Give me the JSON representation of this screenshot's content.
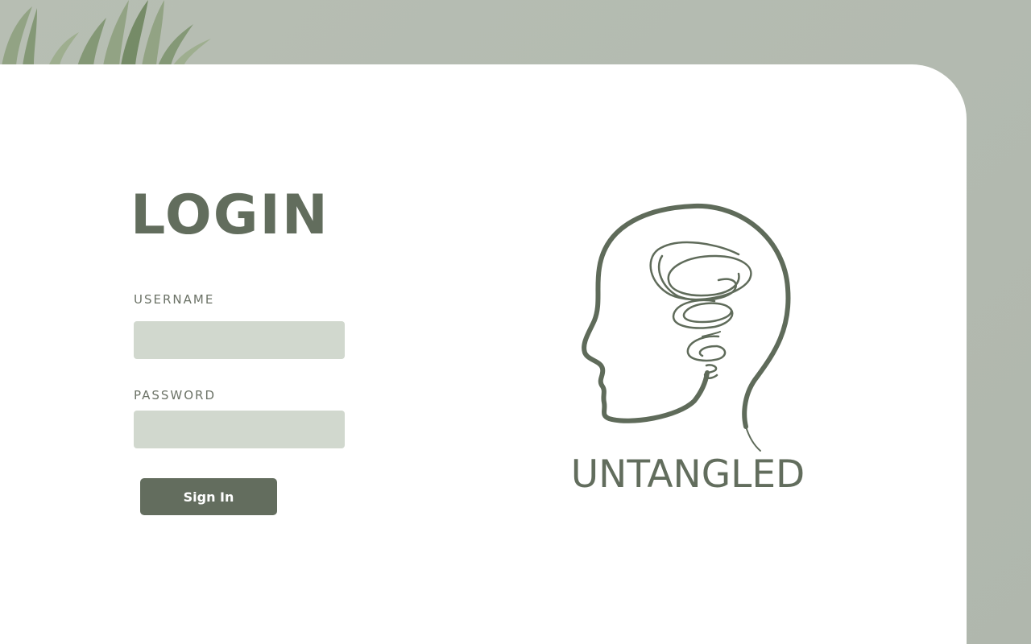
{
  "login": {
    "title": "LOGIN",
    "username_label": "USERNAME",
    "username_value": "",
    "password_label": "PASSWORD",
    "password_value": "",
    "signin_label": "Sign In"
  },
  "brand": {
    "name": "UNTANGLED",
    "logo_icon": "head-with-scribble-brain-icon"
  },
  "colors": {
    "background": "#b3bab0",
    "card": "#ffffff",
    "accent": "#626d5d",
    "input_fill": "#d1d8ce",
    "button": "#636d5e"
  }
}
